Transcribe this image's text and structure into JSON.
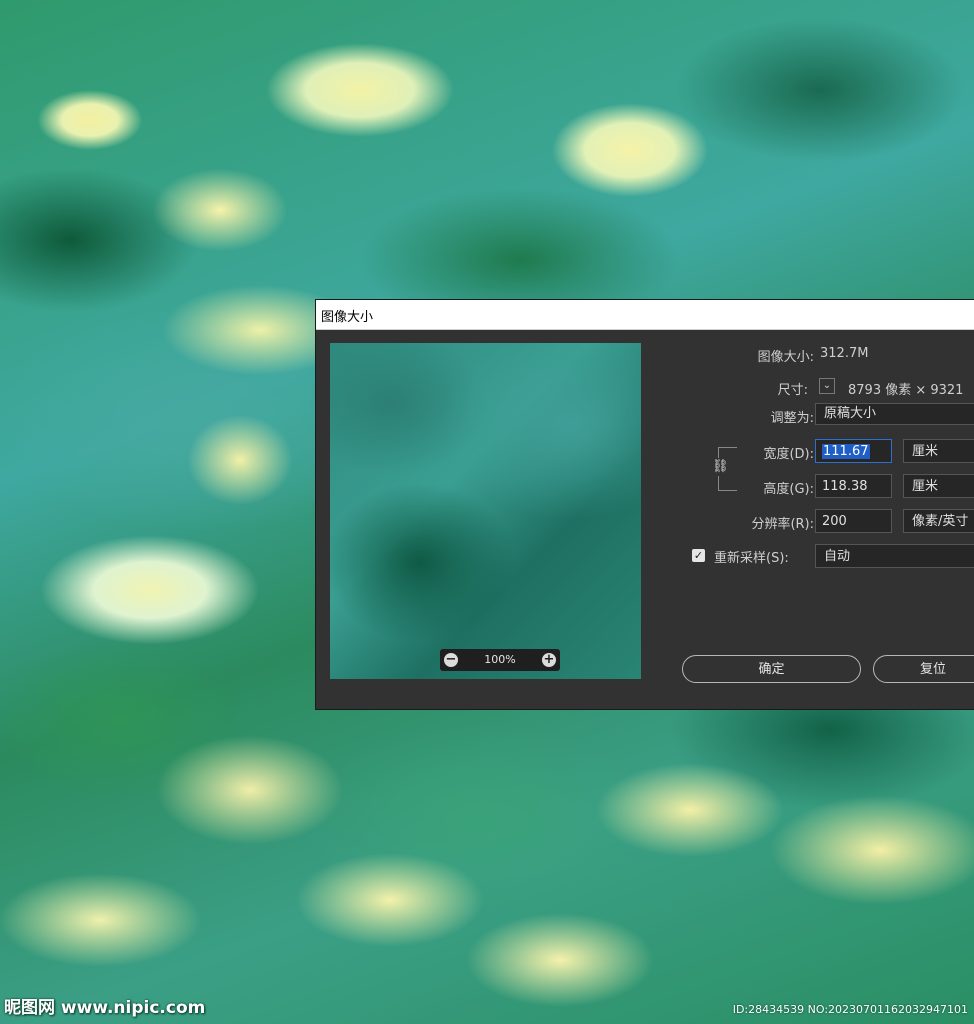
{
  "background": {
    "watermark_left": "昵图网 www.nipic.com",
    "watermark_right": "ID:28434539 NO:20230701162032947101"
  },
  "dialog": {
    "title": "图像大小",
    "image_size_label": "图像大小:",
    "image_size_value": "312.7M",
    "dimensions_label": "尺寸:",
    "dimensions_value": "8793 像素 × 9321",
    "fit_to_label": "调整为:",
    "fit_to_value": "原稿大小",
    "width_label": "宽度(D):",
    "width_value": "111.67",
    "width_unit": "厘米",
    "height_label": "高度(G):",
    "height_value": "118.38",
    "height_unit": "厘米",
    "resolution_label": "分辨率(R):",
    "resolution_value": "200",
    "resolution_unit": "像素/英寸",
    "resample_label": "重新采样(S):",
    "resample_checked": true,
    "resample_value": "自动",
    "zoom_value": "100%",
    "ok_button": "确定",
    "reset_button": "复位"
  }
}
